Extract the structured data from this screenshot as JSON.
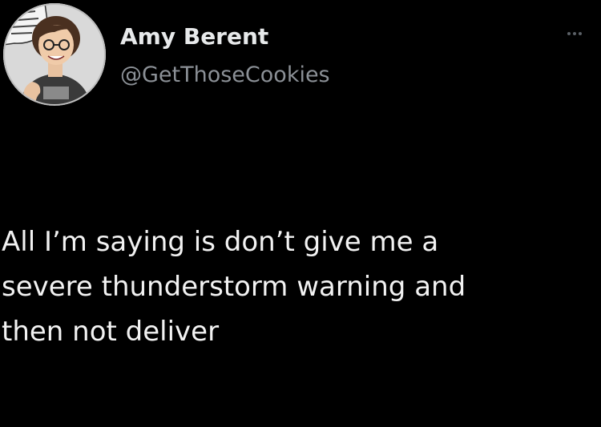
{
  "author": {
    "display_name": "Amy Berent",
    "handle": "@GetThoseCookies",
    "avatar_icon": "illustrated-avatar-icon"
  },
  "menu": {
    "icon": "more-options-icon"
  },
  "tweet": {
    "lines": [
      "All I’m saying is don’t give me a",
      "severe thunderstorm warning and",
      "then not deliver"
    ]
  },
  "colors": {
    "background": "#000000",
    "primary_text": "#e7e9ea",
    "secondary_text": "#8b9096"
  }
}
